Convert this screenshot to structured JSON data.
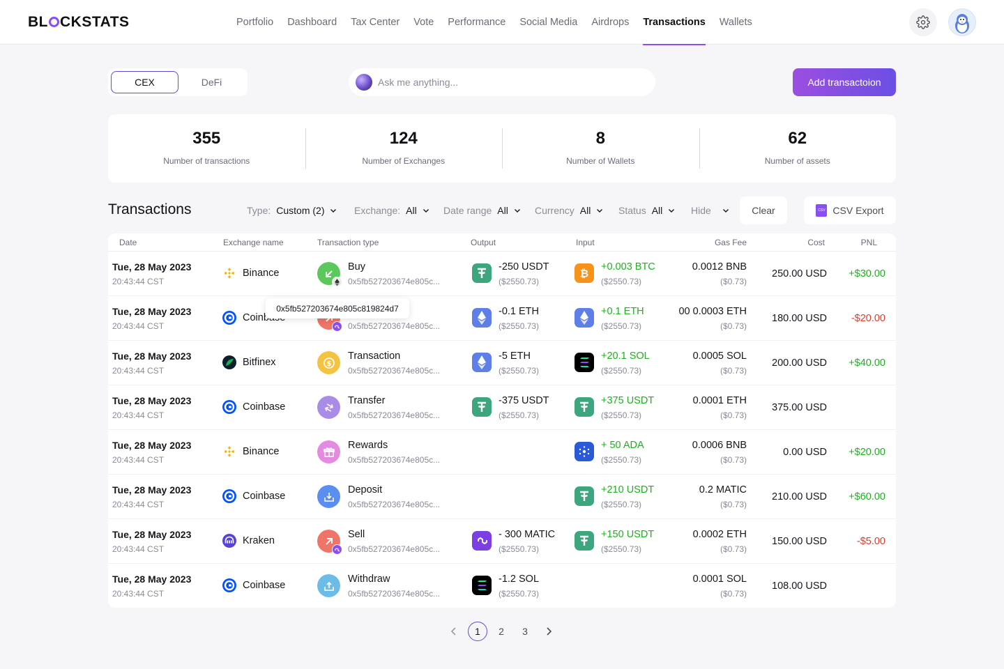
{
  "brand": {
    "logo_left": "BL",
    "logo_right": "CKSTATS"
  },
  "nav": [
    {
      "label": "Portfolio",
      "active": false
    },
    {
      "label": "Dashboard",
      "active": false
    },
    {
      "label": "Tax Center",
      "active": false
    },
    {
      "label": "Vote",
      "active": false
    },
    {
      "label": "Performance",
      "active": false
    },
    {
      "label": "Social Media",
      "active": false
    },
    {
      "label": "Airdrops",
      "active": false
    },
    {
      "label": "Transactions",
      "active": true
    },
    {
      "label": "Wallets",
      "active": false
    }
  ],
  "toolbar": {
    "seg": [
      {
        "label": "CEX",
        "active": true
      },
      {
        "label": "DeFi",
        "active": false
      }
    ],
    "search_placeholder": "Ask me anything...",
    "add_label": "Add transactoion"
  },
  "stats": [
    {
      "value": "355",
      "label": "Number of transactions"
    },
    {
      "value": "124",
      "label": "Number of Exchanges"
    },
    {
      "value": "8",
      "label": "Number of Wallets"
    },
    {
      "value": "62",
      "label": "Number of assets"
    }
  ],
  "section_title": "Transactions",
  "filters": [
    {
      "label": "Type:",
      "value": "Custom (2)"
    },
    {
      "label": "Exchange:",
      "value": "All"
    },
    {
      "label": "Date range",
      "value": "All"
    },
    {
      "label": "Currency",
      "value": "All"
    },
    {
      "label": "Status",
      "value": "All"
    },
    {
      "label": "Hide",
      "value": ""
    }
  ],
  "clear_label": "Clear",
  "csv_label": "CSV Export",
  "csv_icon_text": "CSV",
  "table": {
    "headers": [
      "Date",
      "Exchange name",
      "Transaction type",
      "Output",
      "Input",
      "Gas Fee",
      "Cost",
      "PNL"
    ],
    "rows": [
      {
        "date": "Tue, 28 May 2023",
        "time": "20:43:44 CST",
        "exchange": "Binance",
        "ex_icon": "binance-icon",
        "type": "Buy",
        "type_icon": "buy-arrow-icon",
        "type_color": "#5cc85c",
        "badge": "eth-badge-icon",
        "hash": "0x5fb527203674e805c...",
        "output": {
          "amount": "-250 USDT",
          "usd": "($2550.73)",
          "icon": "usdt-icon"
        },
        "input": {
          "amount": "+0.003 BTC",
          "usd": "($2550.73)",
          "icon": "btc-icon"
        },
        "gas": "0.0012 BNB",
        "gas_usd": "($0.73)",
        "cost": "250.00 USD",
        "pnl": "+$30.00",
        "pnl_dir": "up"
      },
      {
        "date": "Tue, 28 May 2023",
        "time": "20:43:44 CST",
        "exchange": "Coinbase",
        "ex_icon": "coinbase-icon",
        "type": "Sell",
        "type_icon": "sell-arrow-icon",
        "type_color": "#f07468",
        "badge": "polygon-badge-icon",
        "hash": "0x5fb527203674e805c...",
        "output": {
          "amount": "-0.1 ETH",
          "usd": "($2550.73)",
          "icon": "eth-icon"
        },
        "input": {
          "amount": "+0.1 ETH",
          "usd": "($2550.73)",
          "icon": "eth-icon"
        },
        "gas": "00 0.0003 ETH",
        "gas_usd": "($0.73)",
        "cost": "180.00 USD",
        "pnl": "-$20.00",
        "pnl_dir": "down"
      },
      {
        "date": "Tue, 28 May 2023",
        "time": "20:43:44 CST",
        "exchange": "Bitfinex",
        "ex_icon": "bitfinex-icon",
        "type": "Transaction",
        "type_icon": "coin-icon",
        "type_color": "#f5c342",
        "badge": "",
        "hash": "0x5fb527203674e805c...",
        "output": {
          "amount": "-5 ETH",
          "usd": "($2550.73)",
          "icon": "eth-icon"
        },
        "input": {
          "amount": "+20.1 SOL",
          "usd": "($2550.73)",
          "icon": "sol-icon"
        },
        "gas": "0.0005 SOL",
        "gas_usd": "($0.73)",
        "cost": "200.00 USD",
        "pnl": "+$40.00",
        "pnl_dir": "up"
      },
      {
        "date": "Tue, 28 May 2023",
        "time": "20:43:44 CST",
        "exchange": "Coinbase",
        "ex_icon": "coinbase-icon",
        "type": "Transfer",
        "type_icon": "transfer-icon",
        "type_color": "#a98ce8",
        "badge": "",
        "hash": "0x5fb527203674e805c...",
        "output": {
          "amount": "-375 USDT",
          "usd": "($2550.73)",
          "icon": "usdt-icon"
        },
        "input": {
          "amount": "+375 USDT",
          "usd": "($2550.73)",
          "icon": "usdt-icon"
        },
        "gas": "0.0001 ETH",
        "gas_usd": "($0.73)",
        "cost": "375.00 USD",
        "pnl": "",
        "pnl_dir": "up"
      },
      {
        "date": "Tue, 28 May 2023",
        "time": "20:43:44 CST",
        "exchange": "Binance",
        "ex_icon": "binance-icon",
        "type": "Rewards",
        "type_icon": "gift-icon",
        "type_color": "#e48be0",
        "badge": "",
        "hash": "0x5fb527203674e805c...",
        "output": null,
        "input": {
          "amount": "+ 50 ADA",
          "usd": "($2550.73)",
          "icon": "ada-icon"
        },
        "gas": "0.0006 BNB",
        "gas_usd": "($0.73)",
        "cost": "0.00 USD",
        "pnl": "+$20.00",
        "pnl_dir": "up"
      },
      {
        "date": "Tue, 28 May 2023",
        "time": "20:43:44 CST",
        "exchange": "Coinbase",
        "ex_icon": "coinbase-icon",
        "type": "Deposit",
        "type_icon": "deposit-icon",
        "type_color": "#5a8ef0",
        "badge": "",
        "hash": "0x5fb527203674e805c...",
        "output": null,
        "input": {
          "amount": "+210 USDT",
          "usd": "($2550.73)",
          "icon": "usdt-icon"
        },
        "gas": "0.2 MATIC",
        "gas_usd": "($0.73)",
        "cost": "210.00 USD",
        "pnl": "+$60.00",
        "pnl_dir": "up"
      },
      {
        "date": "Tue, 28 May 2023",
        "time": "20:43:44 CST",
        "exchange": "Kraken",
        "ex_icon": "kraken-icon",
        "type": "Sell",
        "type_icon": "sell-arrow-icon",
        "type_color": "#f07468",
        "badge": "polygon-badge-icon",
        "hash": "0x5fb527203674e805c...",
        "output": {
          "amount": "- 300 MATIC",
          "usd": "($2550.73)",
          "icon": "matic-icon"
        },
        "input": {
          "amount": "+150 USDT",
          "usd": "($2550.73)",
          "icon": "usdt-icon"
        },
        "gas": "0.0002 ETH",
        "gas_usd": "($0.73)",
        "cost": "150.00 USD",
        "pnl": "-$5.00",
        "pnl_dir": "down"
      },
      {
        "date": "Tue, 28 May 2023",
        "time": "20:43:44 CST",
        "exchange": "Coinbase",
        "ex_icon": "coinbase-icon",
        "type": "Withdraw",
        "type_icon": "withdraw-icon",
        "type_color": "#6bbde8",
        "badge": "",
        "hash": "0x5fb527203674e805c...",
        "output": {
          "amount": "-1.2 SOL",
          "usd": "($2550.73)",
          "icon": "sol-icon"
        },
        "input": null,
        "gas": "0.0001 SOL",
        "gas_usd": "($0.73)",
        "cost": "108.00 USD",
        "pnl": "",
        "pnl_dir": "up"
      }
    ]
  },
  "tooltip": "0x5fb527203674e805c819824d7",
  "pagination": {
    "pages": [
      "1",
      "2",
      "3"
    ],
    "current": "1"
  },
  "colors": {
    "accent": "#8a4ef5",
    "positive": "#1ab31a",
    "negative": "#e23b2a"
  }
}
